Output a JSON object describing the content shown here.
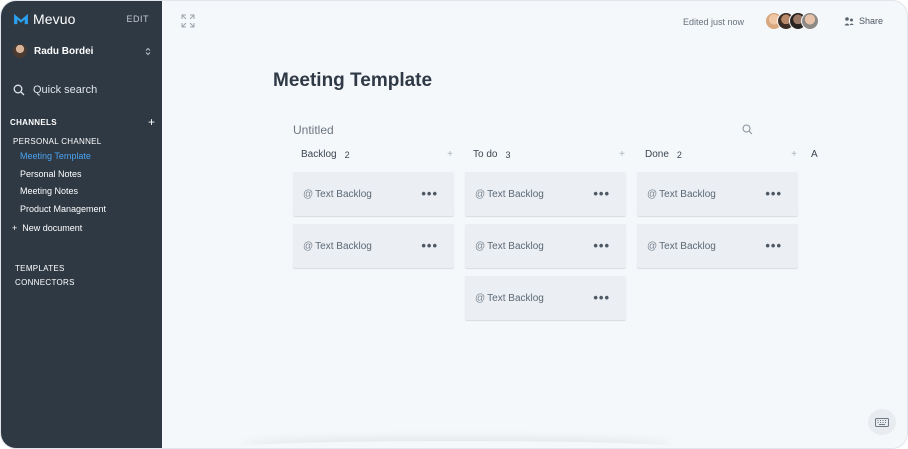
{
  "sidebar": {
    "brand": "Mevuo",
    "edit_label": "EDIT",
    "user_name": "Radu Bordei",
    "search_label": "Quick search",
    "channels_label": "CHANNELS",
    "channel_name": "PERSONAL CHANNEL",
    "documents": [
      {
        "label": "Meeting Template",
        "active": true
      },
      {
        "label": "Personal Notes",
        "active": false
      },
      {
        "label": "Meeting Notes",
        "active": false
      },
      {
        "label": "Product Management",
        "active": false
      }
    ],
    "new_document_label": "New document",
    "templates_label": "TEMPLATES",
    "connectors_label": "CONNECTORS"
  },
  "header": {
    "edited_status": "Edited just now",
    "share_label": "Share",
    "collaborator_count": 4
  },
  "page": {
    "title": "Meeting Template",
    "board_title": "Untitled"
  },
  "board": {
    "columns": [
      {
        "name": "Backlog",
        "count": "2",
        "cards": [
          "Text Backlog",
          "Text Backlog"
        ]
      },
      {
        "name": "To do",
        "count": "3",
        "cards": [
          "Text Backlog",
          "Text Backlog",
          "Text Backlog"
        ]
      },
      {
        "name": "Done",
        "count": "2",
        "cards": [
          "Text Backlog",
          "Text Backlog"
        ]
      }
    ],
    "partial_column_label": "A"
  },
  "colors": {
    "sidebar_bg": "#2f3944",
    "active_link": "#4aa3f0",
    "main_bg": "#f5f8fb",
    "card_bg": "#ebeff4"
  },
  "icons": {
    "expand": "expand-icon",
    "search": "search-icon",
    "share": "share-icon",
    "keyboard": "keyboard-icon"
  }
}
